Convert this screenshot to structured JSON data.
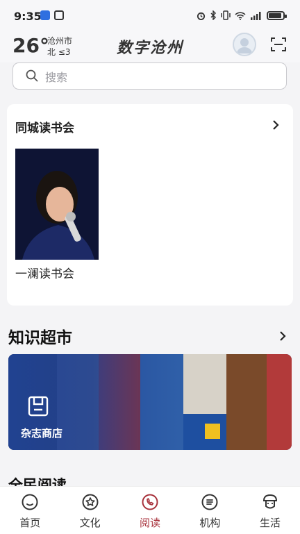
{
  "status_bar": {
    "time": "9:35",
    "left_icons": [
      "app-notification-icon",
      "nfc-icon"
    ],
    "right_icons": [
      "alarm-icon",
      "bluetooth-icon",
      "vibrate-icon",
      "wifi-icon",
      "signal-icon",
      "battery-icon"
    ]
  },
  "header": {
    "temperature": "26°",
    "city": "沧州市",
    "wind": "北 ≤3",
    "app_title": "数字沧州"
  },
  "search": {
    "placeholder": "搜索"
  },
  "reading_club": {
    "title": "同城读书会",
    "items": [
      {
        "label": "一澜读书会"
      }
    ]
  },
  "knowledge_market": {
    "title": "知识超市",
    "banner_label": "杂志商店"
  },
  "next_section": {
    "title": "全民阅读"
  },
  "tabs": [
    {
      "label": "首页",
      "icon": "home-icon",
      "active": false
    },
    {
      "label": "文化",
      "icon": "culture-icon",
      "active": false
    },
    {
      "label": "阅读",
      "icon": "reading-icon",
      "active": true
    },
    {
      "label": "机构",
      "icon": "institution-icon",
      "active": false
    },
    {
      "label": "生活",
      "icon": "life-icon",
      "active": false
    }
  ],
  "colors": {
    "accent": "#a8323c",
    "banner": "#204396"
  }
}
